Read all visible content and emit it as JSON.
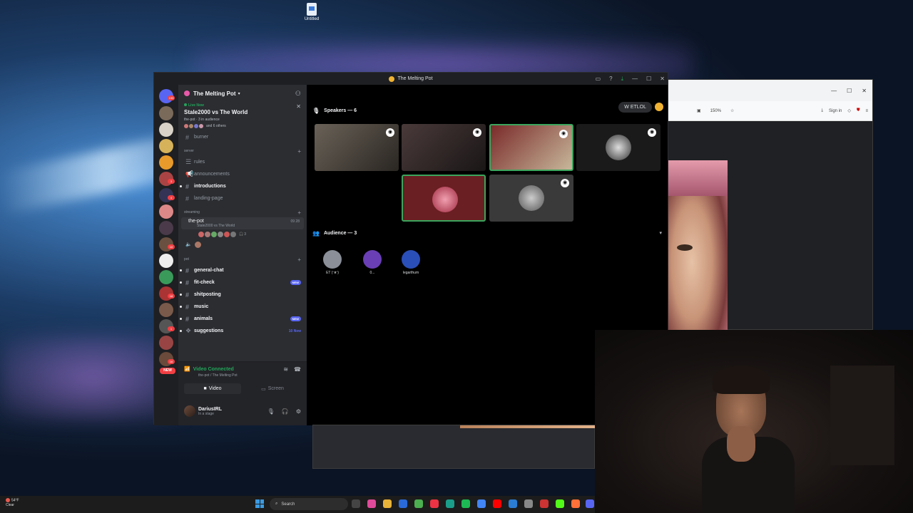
{
  "desktop": {
    "icon_label": "Untitled"
  },
  "window": {
    "title": "The Melting Pot"
  },
  "server": {
    "name": "The Melting Pot",
    "rail_badges": [
      "193",
      "3",
      "4",
      "10",
      "18",
      "1",
      "16"
    ],
    "rail_new": "NEW"
  },
  "live": {
    "status": "Live Now",
    "title": "Stale2000 vs The World",
    "sub": "the-pot · 3 in audience",
    "others": "and 6 others"
  },
  "channels": {
    "burner": "burner",
    "cat_server": "server",
    "rules": "rules",
    "announcements": "announcements",
    "introductions": "introductions",
    "landing_page": "landing-page",
    "cat_streaming": "streaming",
    "voice": {
      "name": "the-pot",
      "sub": "Stale2000 vs The World",
      "counts": "09  28",
      "listeners": "3"
    },
    "cat_pot": "pot",
    "general_chat": "general-chat",
    "fit_check": "fit-check",
    "fit_check_badge": "NEW",
    "shitposting": "shitposting",
    "music": "music",
    "animals": "animals",
    "animals_badge": "NEW",
    "suggestions": "suggestions",
    "suggestions_badge": "10 New"
  },
  "voice_panel": {
    "status": "Video Connected",
    "sub": "the-pot / The Melting Pot",
    "video_label": "Video",
    "screen_label": "Screen"
  },
  "user": {
    "name": "DariusIRL",
    "status": "In a stage"
  },
  "stage": {
    "speakers_label": "Speakers — 6",
    "audience_label": "Audience — 3",
    "top_button": "W ETLOL",
    "audience": [
      {
        "name": "ET (ᵔᴥᵔ)",
        "color": "#8a8f98"
      },
      {
        "name": "0...",
        "color": "#6a3fb5"
      },
      {
        "name": "legarthum",
        "color": "#2b4fb8"
      }
    ]
  },
  "browser": {
    "zoom": "150%",
    "sign_in": "Sign in"
  },
  "taskbar": {
    "temp": "54°F",
    "cond": "Clear",
    "search": "Search"
  },
  "colors": {
    "accent": "#5865f2",
    "green": "#23a55a",
    "red": "#f23f43"
  }
}
